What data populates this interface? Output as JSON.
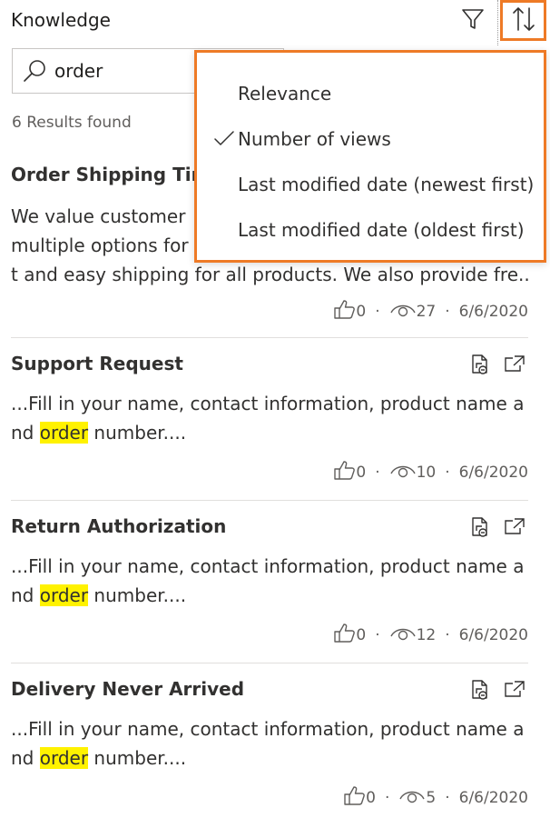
{
  "header": {
    "title": "Knowledge"
  },
  "search": {
    "value": "order"
  },
  "results": {
    "count_text": "6 Results found"
  },
  "articles": [
    {
      "title": "Order Shipping Times",
      "snippet_line1": "We value customer",
      "snippet_line2": "multiple options for",
      "snippet_line3": "t and easy shipping for all products. We also provide fre...",
      "likes": "0",
      "views": "27",
      "date": "6/6/2020"
    },
    {
      "title": "Support Request",
      "snippet_before": "...Fill in your name, contact information, product name a nd ",
      "snippet_highlight": "order",
      "snippet_after": " number....",
      "likes": "0",
      "views": "10",
      "date": "6/6/2020"
    },
    {
      "title": "Return Authorization",
      "snippet_before": "...Fill in your name, contact information, product name a nd ",
      "snippet_highlight": "order",
      "snippet_after": " number....",
      "likes": "0",
      "views": "12",
      "date": "6/6/2020"
    },
    {
      "title": "Delivery Never Arrived",
      "snippet_before": "...Fill in your name, contact information, product name a nd ",
      "snippet_highlight": "order",
      "snippet_after": " number....",
      "likes": "0",
      "views": "5",
      "date": "6/6/2020"
    }
  ],
  "meta_separator": "·",
  "sort_menu": {
    "items": [
      {
        "label": "Relevance",
        "checked": false
      },
      {
        "label": "Number of views",
        "checked": true
      },
      {
        "label": "Last modified date (newest first)",
        "checked": false
      },
      {
        "label": "Last modified date (oldest first)",
        "checked": false
      }
    ]
  },
  "colors": {
    "highlight": "#fff200",
    "focus_outline": "#ee7a26"
  },
  "icons": [
    "filter-icon",
    "sort-icon",
    "search-icon",
    "like-icon",
    "view-icon",
    "link-article-icon",
    "open-external-icon",
    "checkmark-icon"
  ]
}
